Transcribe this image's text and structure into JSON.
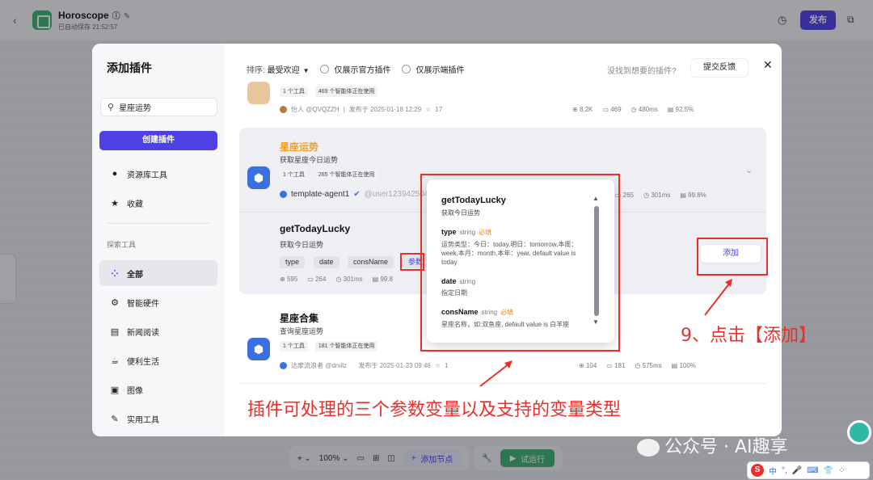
{
  "app": {
    "back": "‹",
    "title": "Horoscope",
    "autosave": "已自动保存 21:52:57",
    "publish": "发布"
  },
  "toolbar": {
    "zoom": "100%",
    "add_node": "添加节点",
    "run": "试运行"
  },
  "modal": {
    "title": "添加插件",
    "search_value": "星座运势",
    "create_button": "创建插件",
    "nav_top": [
      {
        "icon": "user-icon",
        "glyph": "👤",
        "label": "资源库工具"
      },
      {
        "icon": "star-icon",
        "glyph": "★",
        "label": "收藏"
      }
    ],
    "section_label": "探索工具",
    "nav_categories": [
      {
        "icon": "grid-icon",
        "glyph": "⁘",
        "label": "全部",
        "active": true
      },
      {
        "icon": "chip-icon",
        "glyph": "⚙",
        "label": "智能硬件"
      },
      {
        "icon": "news-icon",
        "glyph": "▤",
        "label": "新闻阅读"
      },
      {
        "icon": "cup-icon",
        "glyph": "☕",
        "label": "便利生活"
      },
      {
        "icon": "image-icon",
        "glyph": "▣",
        "label": "图像"
      },
      {
        "icon": "wrench-icon",
        "glyph": "🔧",
        "label": "实用工具"
      }
    ],
    "filter": {
      "sort_label": "排序:",
      "sort_value": "最受欢迎",
      "official_only": "仅展示官方插件",
      "client_only": "仅展示端插件"
    },
    "not_found": "没找到想要的插件?",
    "feedback": "提交反馈",
    "close": "✕"
  },
  "plugins": [
    {
      "tags": [
        "1 个工具",
        "469 个智能体正在使用"
      ],
      "author": "怡人 @QVQZZH",
      "published": "发布于 2025-01-18 12:29",
      "stars": "17",
      "stats": [
        "8.2K",
        "469",
        "480ms",
        "92.5%"
      ]
    },
    {
      "name": "星座运势",
      "desc": "获取星座今日运势",
      "tags": [
        "1 个工具",
        "265 个智能体正在使用"
      ],
      "author": "template-agent1",
      "author_handle": "@user1239425040",
      "stats": [
        "265",
        "301ms",
        "99.8%"
      ],
      "tool": {
        "name": "getTodayLucky",
        "desc": "获取今日运势",
        "params": [
          "type",
          "date",
          "consName"
        ],
        "params_button": "参数",
        "stats": [
          "595",
          "264",
          "301ms",
          "99.8"
        ],
        "add": "添加"
      }
    },
    {
      "name": "星座合集",
      "desc": "查询星座运势",
      "tags": [
        "1 个工具",
        "181 个智能体正在使用"
      ],
      "author": "达摩流浪者 @dmllz",
      "published": "发布于 2025-01-23 09:46",
      "stars": "1",
      "stats": [
        "104",
        "181",
        "575ms",
        "100%"
      ]
    }
  ],
  "popup": {
    "title": "getTodayLucky",
    "desc": "获取今日运势",
    "required": "必填",
    "params": [
      {
        "name": "type",
        "type": "string",
        "required": true,
        "desc": "运势类型：今日：today,明日：tomorrow,本周：week,本月：month,本年：year, default value is today"
      },
      {
        "name": "date",
        "type": "string",
        "required": false,
        "desc": "指定日期"
      },
      {
        "name": "consName",
        "type": "string",
        "required": true,
        "desc": "星座名称，如:双鱼座, default value is 白羊座"
      }
    ]
  },
  "annotations": {
    "step": "9、点击【添加】",
    "caption": "插件可处理的三个参数变量以及支持的变量类型",
    "color": "#e8302c"
  },
  "watermark": "公众号 · AI趣享",
  "ime": [
    "中",
    "°,",
    "🎤",
    "⌨",
    "👕",
    "⁘"
  ]
}
